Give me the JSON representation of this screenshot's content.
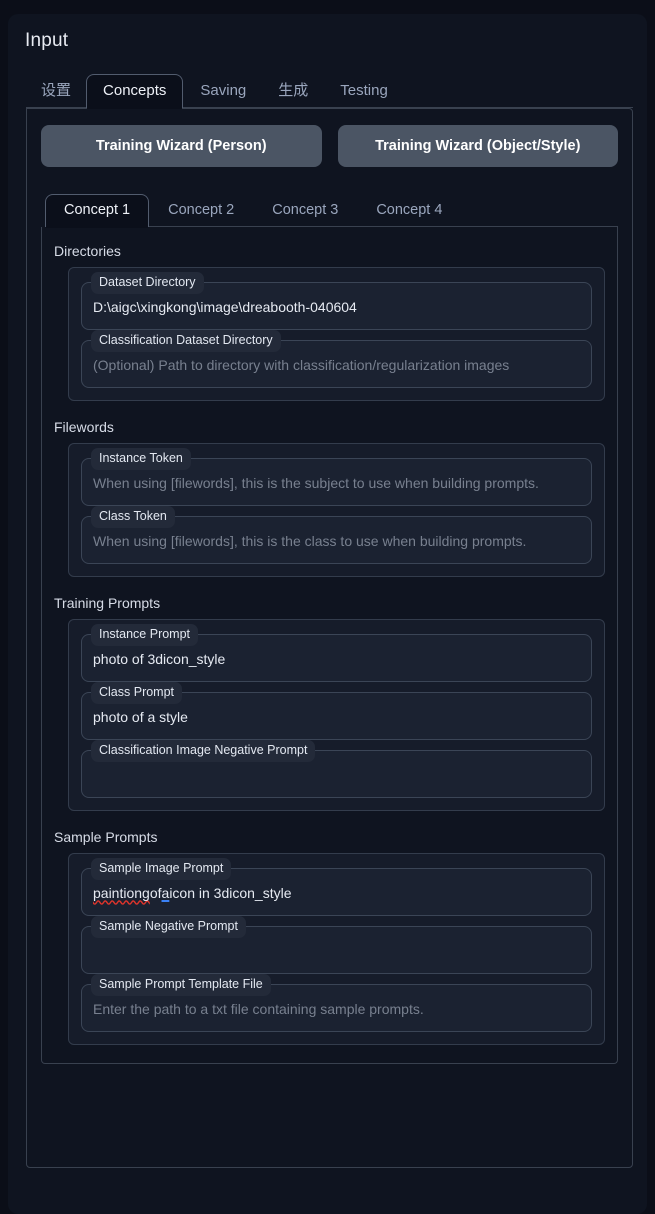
{
  "header": {
    "title": "Input"
  },
  "main_tabs": [
    {
      "label": "设置",
      "active": false,
      "cjk": true
    },
    {
      "label": "Concepts",
      "active": true,
      "cjk": false
    },
    {
      "label": "Saving",
      "active": false,
      "cjk": false
    },
    {
      "label": "生成",
      "active": false,
      "cjk": true
    },
    {
      "label": "Testing",
      "active": false,
      "cjk": false
    }
  ],
  "wizard_buttons": [
    {
      "label": "Training Wizard (Person)"
    },
    {
      "label": "Training Wizard (Object/Style)"
    }
  ],
  "concept_tabs": [
    {
      "label": "Concept 1",
      "active": true
    },
    {
      "label": "Concept 2",
      "active": false
    },
    {
      "label": "Concept 3",
      "active": false
    },
    {
      "label": "Concept 4",
      "active": false
    }
  ],
  "sections": {
    "directories": {
      "title": "Directories",
      "fields": {
        "dataset_directory": {
          "label": "Dataset Directory",
          "value": "D:\\aigc\\xingkong\\image\\dreabooth-040604",
          "placeholder": ""
        },
        "classification_dataset_directory": {
          "label": "Classification Dataset Directory",
          "value": "",
          "placeholder": "(Optional) Path to directory with classification/regularization images"
        }
      }
    },
    "filewords": {
      "title": "Filewords",
      "fields": {
        "instance_token": {
          "label": "Instance Token",
          "value": "",
          "placeholder": "When using [filewords], this is the subject to use when building prompts."
        },
        "class_token": {
          "label": "Class Token",
          "value": "",
          "placeholder": "When using [filewords], this is the class to use when building prompts."
        }
      }
    },
    "training_prompts": {
      "title": "Training Prompts",
      "fields": {
        "instance_prompt": {
          "label": "Instance Prompt",
          "value": "photo of 3dicon_style",
          "placeholder": ""
        },
        "class_prompt": {
          "label": "Class Prompt",
          "value": "photo of a style",
          "placeholder": ""
        },
        "classification_image_negative_prompt": {
          "label": "Classification Image Negative Prompt",
          "value": "",
          "placeholder": ""
        }
      }
    },
    "sample_prompts": {
      "title": "Sample Prompts",
      "fields": {
        "sample_image_prompt": {
          "label": "Sample Image Prompt",
          "value": "paintiong of a icon in 3dicon_style",
          "value_parts": [
            {
              "text": "paintiong",
              "mark": "misspell"
            },
            {
              "text": " of ",
              "mark": "none"
            },
            {
              "text": "a",
              "mark": "grammar"
            },
            {
              "text": " icon in 3dicon_style",
              "mark": "none"
            }
          ],
          "placeholder": ""
        },
        "sample_negative_prompt": {
          "label": "Sample Negative Prompt",
          "value": "",
          "placeholder": ""
        },
        "sample_prompt_template_file": {
          "label": "Sample Prompt Template File",
          "value": "",
          "placeholder": "Enter the path to a txt file containing sample prompts."
        }
      }
    }
  },
  "colors": {
    "page_background": "#0b0e18",
    "panel_background": "#0f1420",
    "button_background": "#4b5564",
    "border": "#39414f",
    "field_background": "#1b2231",
    "group_background": "#161c2a",
    "text_primary": "#e6eaf2",
    "text_muted": "#9aa6bd",
    "placeholder": "#78808f",
    "misspell_underline": "#e0342b",
    "grammar_underline": "#3b82f6"
  }
}
